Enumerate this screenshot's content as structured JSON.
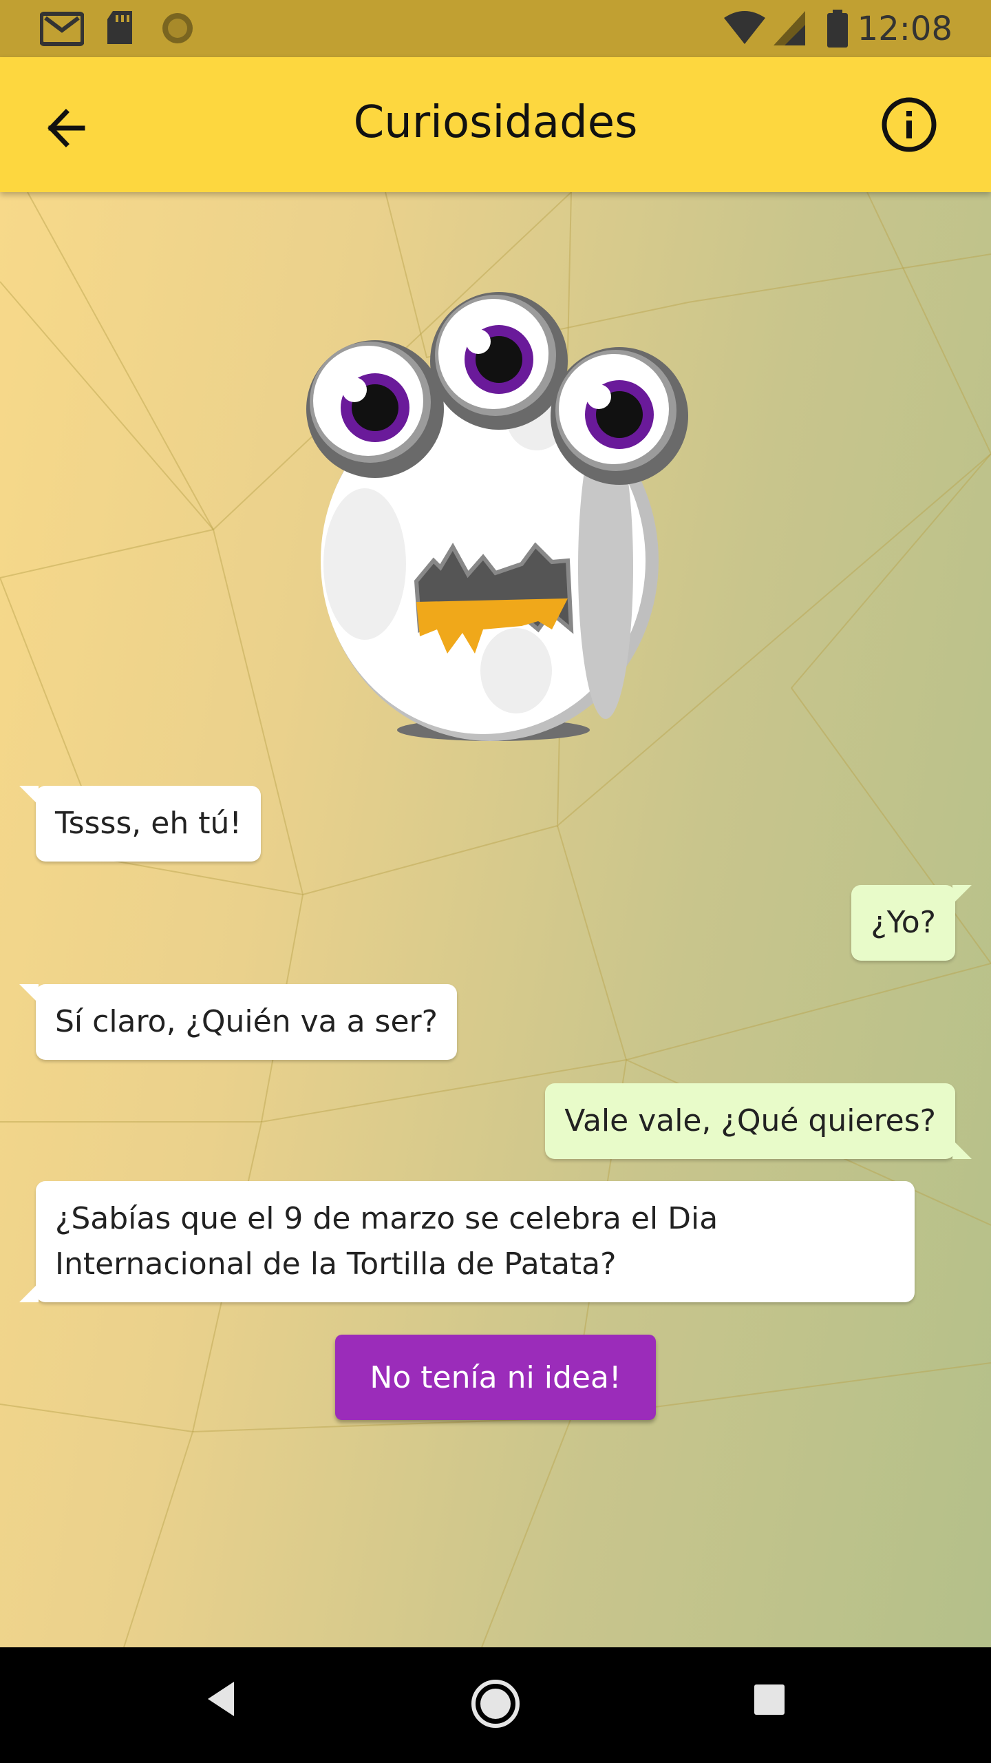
{
  "status_bar": {
    "time": "12:08",
    "icons": [
      "gmail-icon",
      "sd-card-icon",
      "sync-icon",
      "wifi-icon",
      "signal-icon",
      "battery-icon"
    ]
  },
  "app_bar": {
    "title": "Curiosidades",
    "back_icon": "arrow-back-icon",
    "info_icon": "info-icon"
  },
  "messages": [
    {
      "side": "in",
      "text": "Tssss, eh tú!"
    },
    {
      "side": "out",
      "text": "¿Yo?"
    },
    {
      "side": "in",
      "text": "Sí claro, ¿Quién va a ser?"
    },
    {
      "side": "out",
      "text": "Vale vale, ¿Qué quieres?"
    },
    {
      "side": "in",
      "text": "¿Sabías que el 9 de marzo se celebra el Dia Internacional de la Tortilla de Patata?"
    }
  ],
  "action_button": {
    "label": "No tenía ni idea!",
    "color": "#9b2cba"
  },
  "colors": {
    "status_bar": "#c1a032",
    "app_bar": "#fdd73f",
    "bubble_in": "#ffffff",
    "bubble_out": "#e8fbc9"
  },
  "nav_bar": {
    "icons": [
      "nav-back-icon",
      "nav-home-icon",
      "nav-recents-icon"
    ]
  }
}
